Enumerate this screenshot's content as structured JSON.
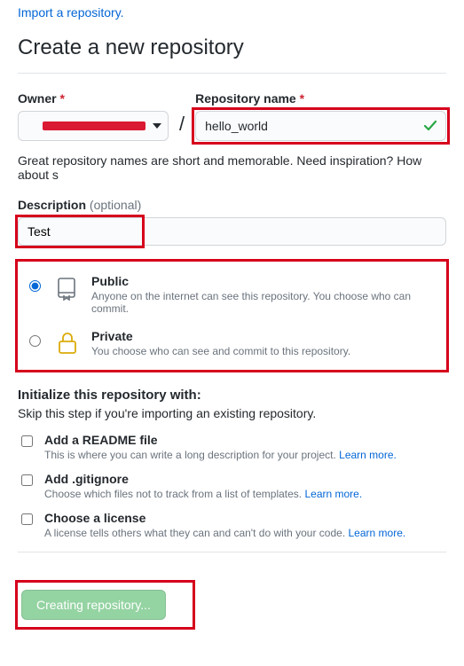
{
  "top_link": "Import a repository.",
  "heading": "Create a new repository",
  "owner": {
    "label": "Owner",
    "value": ""
  },
  "repo": {
    "label": "Repository name",
    "value": "hello_world"
  },
  "hint": "Great repository names are short and memorable. Need inspiration? How about s",
  "description": {
    "label": "Description",
    "optional": "(optional)",
    "value": "Test"
  },
  "visibility": {
    "public": {
      "title": "Public",
      "desc": "Anyone on the internet can see this repository. You choose who can commit."
    },
    "private": {
      "title": "Private",
      "desc": "You choose who can see and commit to this repository."
    }
  },
  "init": {
    "title": "Initialize this repository with:",
    "sub": "Skip this step if you're importing an existing repository.",
    "readme": {
      "title": "Add a README file",
      "desc": "This is where you can write a long description for your project. ",
      "link": "Learn more."
    },
    "gitignore": {
      "title": "Add .gitignore",
      "desc": "Choose which files not to track from a list of templates. ",
      "link": "Learn more."
    },
    "license": {
      "title": "Choose a license",
      "desc": "A license tells others what they can and can't do with your code. ",
      "link": "Learn more."
    }
  },
  "button": "Creating repository..."
}
